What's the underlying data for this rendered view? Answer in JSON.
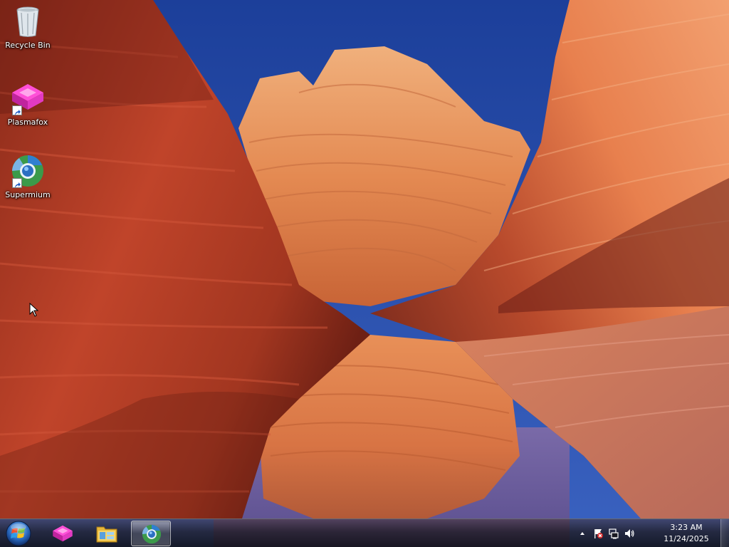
{
  "desktop": {
    "icons": [
      {
        "label": "Recycle Bin",
        "icon": "recycle-bin-icon",
        "shortcut": false
      },
      {
        "label": "Plasmafox",
        "icon": "plasmafox-icon",
        "shortcut": true
      },
      {
        "label": "Supermium",
        "icon": "supermium-icon",
        "shortcut": true
      }
    ]
  },
  "taskbar": {
    "start_icon": "windows-start-orb",
    "pinned": [
      {
        "icon": "plasmafox-icon",
        "active": false
      },
      {
        "icon": "file-explorer-icon",
        "active": false
      },
      {
        "icon": "supermium-icon",
        "active": true
      }
    ],
    "tray": {
      "icons": [
        "show-hidden-icons-arrow",
        "action-center-flag-icon",
        "network-icon",
        "volume-icon"
      ],
      "time": "3:23 AM",
      "date": "11/24/2025"
    }
  },
  "colors": {
    "sky": "#2a4fa8",
    "rock_dark": "#7a2418",
    "rock_mid": "#c4502a",
    "rock_light": "#f0a070",
    "taskbar": "#1a1a22"
  }
}
